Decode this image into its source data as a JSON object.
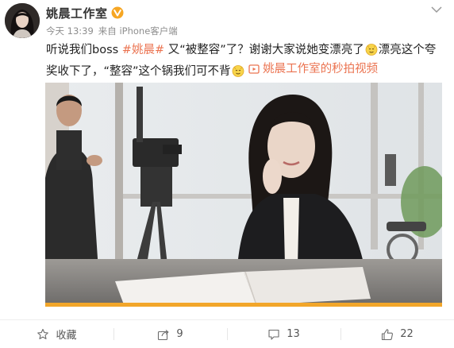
{
  "post": {
    "author": "姚晨工作室",
    "time": "今天 13:39",
    "source": "来自 iPhone客户端",
    "text": {
      "part1": "听说我们boss ",
      "hashtag": "#姚晨#",
      "part2": " 又“被整容”了？谢谢大家说她变漂亮了",
      "part3": "漂亮这个夸奖收下了，“整容”这个锅我们可不背",
      "video_link": "姚晨工作室的秒拍视频"
    },
    "video": {
      "progress_percent": 100
    }
  },
  "actions": {
    "favorite_label": "收藏",
    "share_count": "9",
    "comment_count": "13",
    "like_count": "22"
  },
  "colors": {
    "accent": "#eb7350",
    "verified": "#f6a623",
    "progress": "#f2a62a"
  }
}
